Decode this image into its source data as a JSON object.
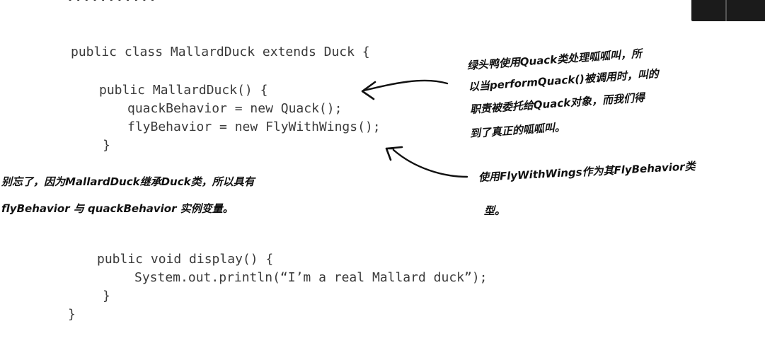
{
  "top_fragment": "· · · · · · · · · · ·",
  "code": {
    "line1": "public class MallardDuck extends Duck {",
    "line2": "public MallardDuck() {",
    "line3": "quackBehavior = new Quack();",
    "line4": "flyBehavior = new FlyWithWings();",
    "line5": "}",
    "line6": "public void display() {",
    "line7": "System.out.println(“I’m a real Mallard duck”);",
    "line8": "}",
    "line9": "}"
  },
  "annotations": {
    "quack_note": [
      "绿头鸭使用Quack类处理呱呱叫，所",
      "以当performQuack()被调用时，叫的",
      "职责被委托给Quack对象，而我们得",
      "到了真正的呱呱叫。"
    ],
    "inherit_note": [
      "别忘了，因为MallardDuck继承Duck类，所以具有",
      "flyBehavior 与 quackBehavior 实例变量。"
    ],
    "fly_note": [
      "使用FlyWithWings作为其FlyBehavior类",
      "型。"
    ]
  }
}
